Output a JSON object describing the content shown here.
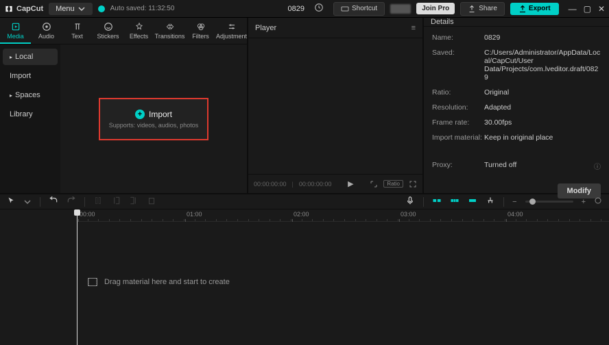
{
  "titlebar": {
    "app_name": "CapCut",
    "menu_label": "Menu",
    "autosave": "Auto saved: 11:32:50",
    "project_name": "0829",
    "shortcut": "Shortcut",
    "join_pro": "Join Pro",
    "share": "Share",
    "export": "Export"
  },
  "asset_tabs": [
    {
      "label": "Media"
    },
    {
      "label": "Audio"
    },
    {
      "label": "Text"
    },
    {
      "label": "Stickers"
    },
    {
      "label": "Effects"
    },
    {
      "label": "Transitions"
    },
    {
      "label": "Filters"
    },
    {
      "label": "Adjustment"
    }
  ],
  "media_side": {
    "local": "Local",
    "import": "Import",
    "spaces": "Spaces",
    "library": "Library"
  },
  "import_box": {
    "label": "Import",
    "sub": "Supports: videos, audios, photos"
  },
  "player": {
    "title": "Player",
    "time_a": "00:00:00:00",
    "time_b": "00:00:00:00",
    "ratio": "Ratio"
  },
  "details": {
    "title": "Details",
    "rows": {
      "name_l": "Name:",
      "name_v": "0829",
      "saved_l": "Saved:",
      "saved_v": "C:/Users/Administrator/AppData/Local/CapCut/User Data/Projects/com.lveditor.draft/0829",
      "ratio_l": "Ratio:",
      "ratio_v": "Original",
      "res_l": "Resolution:",
      "res_v": "Adapted",
      "fr_l": "Frame rate:",
      "fr_v": "30.00fps",
      "im_l": "Import material:",
      "im_v": "Keep in original place",
      "proxy_l": "Proxy:",
      "proxy_v": "Turned off"
    },
    "modify": "Modify"
  },
  "timeline": {
    "ticks": [
      "00:00",
      "01:00",
      "02:00",
      "03:00",
      "04:00"
    ],
    "hint": "Drag material here and start to create"
  }
}
